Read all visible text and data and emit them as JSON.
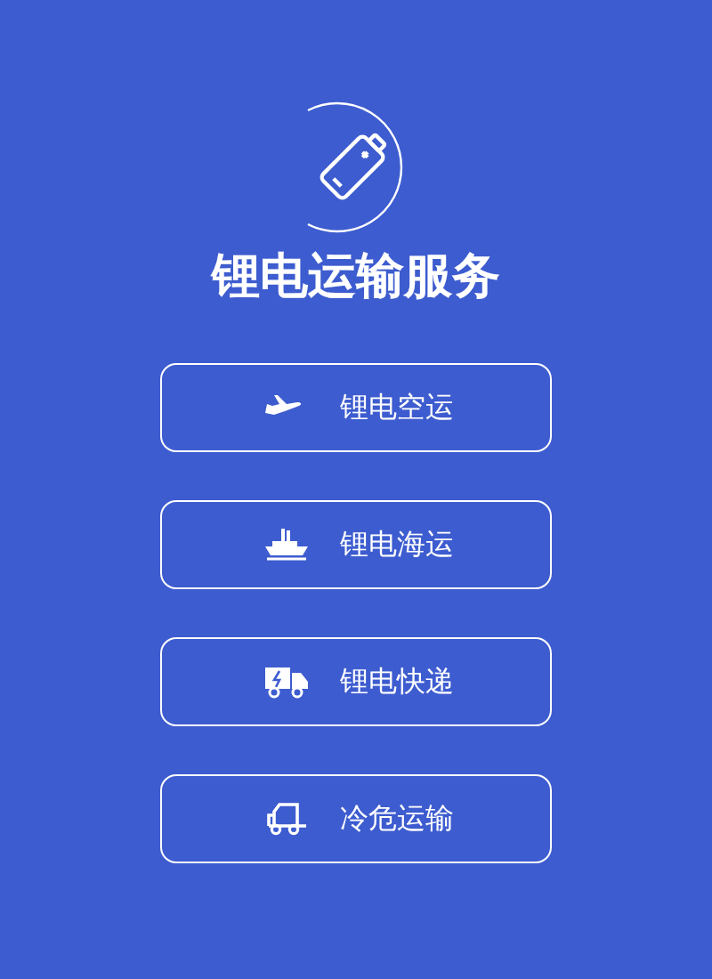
{
  "title": "锂电运输服务",
  "services": [
    {
      "label": "锂电空运",
      "kind": "plane"
    },
    {
      "label": "锂电海运",
      "kind": "ship"
    },
    {
      "label": "锂电快递",
      "kind": "truck"
    },
    {
      "label": "冷危运输",
      "kind": "van"
    }
  ]
}
